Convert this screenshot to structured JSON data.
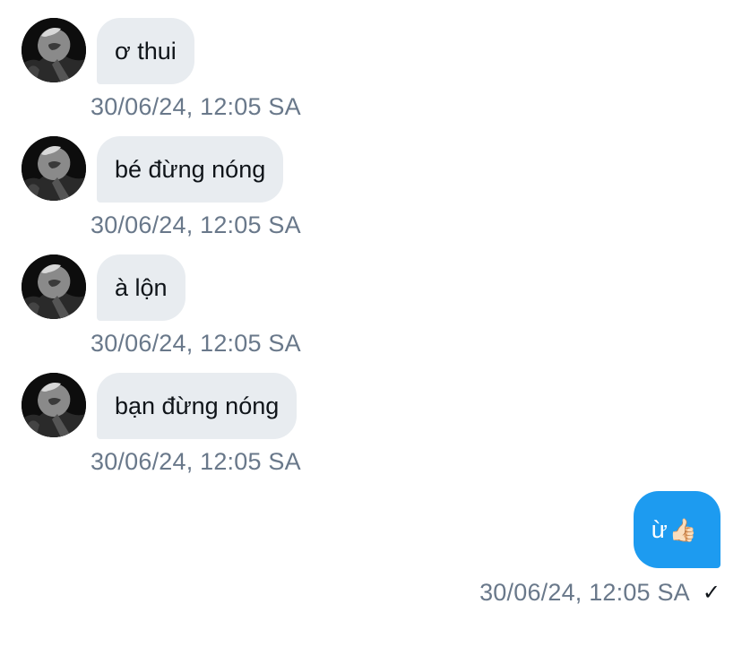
{
  "conversation": {
    "incoming": [
      {
        "text": "ơ thui",
        "time": "30/06/24, 12:05 SA",
        "avatar_icon": "profile-photo-icon"
      },
      {
        "text": "bé đừng nóng",
        "time": "30/06/24, 12:05 SA",
        "avatar_icon": "profile-photo-icon"
      },
      {
        "text": "à lộn",
        "time": "30/06/24, 12:05 SA",
        "avatar_icon": "profile-photo-icon"
      },
      {
        "text": "bạn đừng nóng",
        "time": "30/06/24, 12:05 SA",
        "avatar_icon": "profile-photo-icon"
      }
    ],
    "outgoing": {
      "text": "ừ",
      "emoji": "👍🏻",
      "time": "30/06/24, 12:05 SA",
      "status_icon": "checkmark-icon",
      "status_glyph": "✓"
    }
  },
  "colors": {
    "incoming_bubble": "#e8ecf0",
    "outgoing_bubble": "#1d9bf0",
    "timestamp": "#69788a",
    "text": "#0f1419"
  }
}
